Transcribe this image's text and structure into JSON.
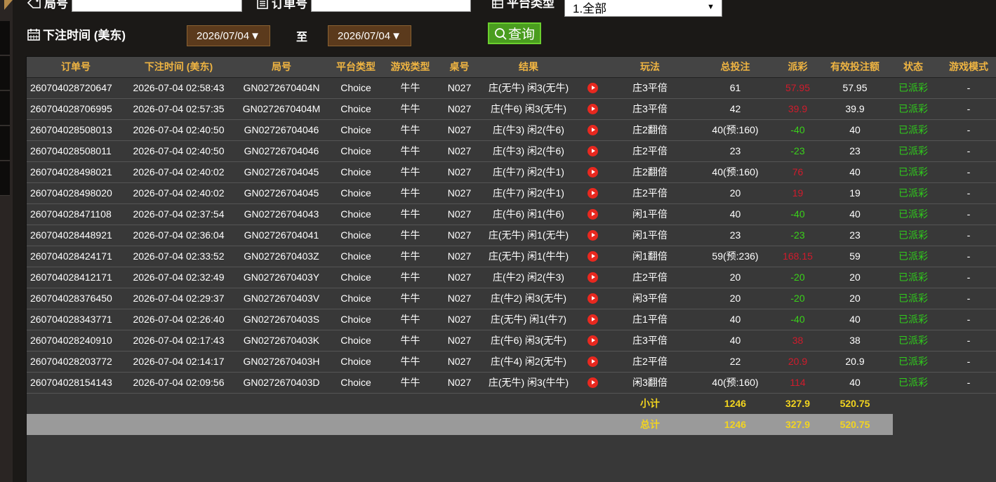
{
  "filters": {
    "round_label": "局号",
    "order_label": "订单号",
    "platform_label": "平台类型",
    "platform_value": "1.全部",
    "bet_time_label": "下注时间 (美东)",
    "date_from": "2026/07/04",
    "date_to_label": "至",
    "date_to": "2026/07/04",
    "query_label": "查询"
  },
  "table": {
    "headers": [
      "订单号",
      "下注时间 (美东)",
      "局号",
      "平台类型",
      "游戏类型",
      "桌号",
      "结果",
      "玩法",
      "总投注",
      "派彩",
      "有效投注额",
      "状态",
      "游戏模式"
    ],
    "rows": [
      {
        "order": "260704028720647",
        "time": "2026-07-04 02:58:43",
        "round": "GN0272670404N",
        "platform": "Choice",
        "game": "牛牛",
        "table": "N027",
        "result": "庄(无牛) 闲3(无牛)",
        "play": "庄3平倍",
        "bet": "61",
        "payout": "57.95",
        "payout_color": "red",
        "valid": "57.95",
        "status": "已派彩",
        "mode": "-"
      },
      {
        "order": "260704028706995",
        "time": "2026-07-04 02:57:35",
        "round": "GN0272670404M",
        "platform": "Choice",
        "game": "牛牛",
        "table": "N027",
        "result": "庄(牛6) 闲3(无牛)",
        "play": "庄3平倍",
        "bet": "42",
        "payout": "39.9",
        "payout_color": "red",
        "valid": "39.9",
        "status": "已派彩",
        "mode": "-"
      },
      {
        "order": "260704028508013",
        "time": "2026-07-04 02:40:50",
        "round": "GN02726704046",
        "platform": "Choice",
        "game": "牛牛",
        "table": "N027",
        "result": "庄(牛3) 闲2(牛6)",
        "play": "庄2翻倍",
        "bet": "40(预:160)",
        "payout": "-40",
        "payout_color": "green",
        "valid": "40",
        "status": "已派彩",
        "mode": "-"
      },
      {
        "order": "260704028508011",
        "time": "2026-07-04 02:40:50",
        "round": "GN02726704046",
        "platform": "Choice",
        "game": "牛牛",
        "table": "N027",
        "result": "庄(牛3) 闲2(牛6)",
        "play": "庄2平倍",
        "bet": "23",
        "payout": "-23",
        "payout_color": "green",
        "valid": "23",
        "status": "已派彩",
        "mode": "-"
      },
      {
        "order": "260704028498021",
        "time": "2026-07-04 02:40:02",
        "round": "GN02726704045",
        "platform": "Choice",
        "game": "牛牛",
        "table": "N027",
        "result": "庄(牛7) 闲2(牛1)",
        "play": "庄2翻倍",
        "bet": "40(预:160)",
        "payout": "76",
        "payout_color": "red",
        "valid": "40",
        "status": "已派彩",
        "mode": "-"
      },
      {
        "order": "260704028498020",
        "time": "2026-07-04 02:40:02",
        "round": "GN02726704045",
        "platform": "Choice",
        "game": "牛牛",
        "table": "N027",
        "result": "庄(牛7) 闲2(牛1)",
        "play": "庄2平倍",
        "bet": "20",
        "payout": "19",
        "payout_color": "red",
        "valid": "19",
        "status": "已派彩",
        "mode": "-"
      },
      {
        "order": "260704028471108",
        "time": "2026-07-04 02:37:54",
        "round": "GN02726704043",
        "platform": "Choice",
        "game": "牛牛",
        "table": "N027",
        "result": "庄(牛6) 闲1(牛6)",
        "play": "闲1平倍",
        "bet": "40",
        "payout": "-40",
        "payout_color": "green",
        "valid": "40",
        "status": "已派彩",
        "mode": "-"
      },
      {
        "order": "260704028448921",
        "time": "2026-07-04 02:36:04",
        "round": "GN02726704041",
        "platform": "Choice",
        "game": "牛牛",
        "table": "N027",
        "result": "庄(无牛) 闲1(无牛)",
        "play": "闲1平倍",
        "bet": "23",
        "payout": "-23",
        "payout_color": "green",
        "valid": "23",
        "status": "已派彩",
        "mode": "-"
      },
      {
        "order": "260704028424171",
        "time": "2026-07-04 02:33:52",
        "round": "GN0272670403Z",
        "platform": "Choice",
        "game": "牛牛",
        "table": "N027",
        "result": "庄(无牛) 闲1(牛牛)",
        "play": "闲1翻倍",
        "bet": "59(预:236)",
        "payout": "168.15",
        "payout_color": "red",
        "valid": "59",
        "status": "已派彩",
        "mode": "-"
      },
      {
        "order": "260704028412171",
        "time": "2026-07-04 02:32:49",
        "round": "GN0272670403Y",
        "platform": "Choice",
        "game": "牛牛",
        "table": "N027",
        "result": "庄(牛2) 闲2(牛3)",
        "play": "庄2平倍",
        "bet": "20",
        "payout": "-20",
        "payout_color": "green",
        "valid": "20",
        "status": "已派彩",
        "mode": "-"
      },
      {
        "order": "260704028376450",
        "time": "2026-07-04 02:29:37",
        "round": "GN0272670403V",
        "platform": "Choice",
        "game": "牛牛",
        "table": "N027",
        "result": "庄(牛2) 闲3(无牛)",
        "play": "闲3平倍",
        "bet": "20",
        "payout": "-20",
        "payout_color": "green",
        "valid": "20",
        "status": "已派彩",
        "mode": "-"
      },
      {
        "order": "260704028343771",
        "time": "2026-07-04 02:26:40",
        "round": "GN0272670403S",
        "platform": "Choice",
        "game": "牛牛",
        "table": "N027",
        "result": "庄(无牛) 闲1(牛7)",
        "play": "庄1平倍",
        "bet": "40",
        "payout": "-40",
        "payout_color": "green",
        "valid": "40",
        "status": "已派彩",
        "mode": "-"
      },
      {
        "order": "260704028240910",
        "time": "2026-07-04 02:17:43",
        "round": "GN0272670403K",
        "platform": "Choice",
        "game": "牛牛",
        "table": "N027",
        "result": "庄(牛6) 闲3(无牛)",
        "play": "庄3平倍",
        "bet": "40",
        "payout": "38",
        "payout_color": "red",
        "valid": "38",
        "status": "已派彩",
        "mode": "-"
      },
      {
        "order": "260704028203772",
        "time": "2026-07-04 02:14:17",
        "round": "GN0272670403H",
        "platform": "Choice",
        "game": "牛牛",
        "table": "N027",
        "result": "庄(牛4) 闲2(无牛)",
        "play": "庄2平倍",
        "bet": "22",
        "payout": "20.9",
        "payout_color": "red",
        "valid": "20.9",
        "status": "已派彩",
        "mode": "-"
      },
      {
        "order": "260704028154143",
        "time": "2026-07-04 02:09:56",
        "round": "GN0272670403D",
        "platform": "Choice",
        "game": "牛牛",
        "table": "N027",
        "result": "庄(无牛) 闲3(牛牛)",
        "play": "闲3翻倍",
        "bet": "40(预:160)",
        "payout": "114",
        "payout_color": "red",
        "valid": "40",
        "status": "已派彩",
        "mode": "-"
      }
    ],
    "subtotal": {
      "label": "小计",
      "bet": "1246",
      "payout": "327.9",
      "valid": "520.75"
    },
    "total": {
      "label": "总计",
      "bet": "1246",
      "payout": "327.9",
      "valid": "520.75"
    }
  },
  "colors": {
    "header_text": "#f0b542",
    "payout_red": "#d11b2c",
    "payout_green": "#3ad11a",
    "status_green": "#2fcc1b",
    "summary_yellow": "#f2d41f",
    "query_button": "#4a9d1f",
    "date_button": "#5b3a1c"
  },
  "icons": {
    "round": "tag-icon",
    "order": "clipboard-icon",
    "platform": "list-icon",
    "bet_time": "calendar-icon",
    "query": "search-icon",
    "replay": "play-icon"
  }
}
